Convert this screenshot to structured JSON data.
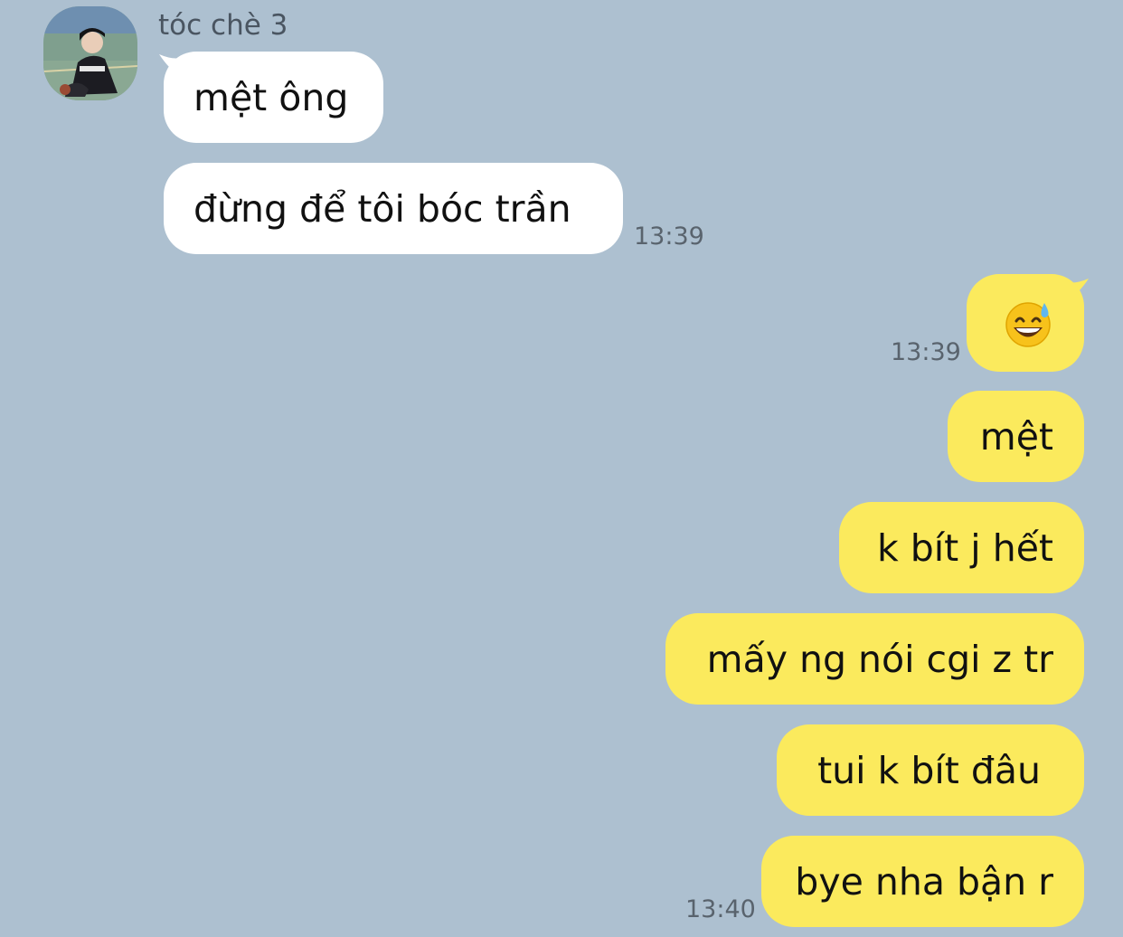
{
  "chat": {
    "sender_name": "tóc chè 3",
    "colors": {
      "background": "#adc0d0",
      "incoming_bubble": "#ffffff",
      "outgoing_bubble": "#fbea5d",
      "timestamp": "#59636d"
    },
    "messages": [
      {
        "direction": "incoming",
        "text": "mệt ông",
        "time": ""
      },
      {
        "direction": "incoming",
        "text": "đừng để tôi bóc trần",
        "time": "13:39"
      },
      {
        "direction": "outgoing",
        "type": "emoji",
        "icon": "grinning-face-with-sweat-icon",
        "text": "",
        "time": "13:39"
      },
      {
        "direction": "outgoing",
        "text": "mệt",
        "time": ""
      },
      {
        "direction": "outgoing",
        "text": "k bít j hết",
        "time": ""
      },
      {
        "direction": "outgoing",
        "text": "mấy ng nói cgi z tr",
        "time": ""
      },
      {
        "direction": "outgoing",
        "text": "tui k bít đâu",
        "time": ""
      },
      {
        "direction": "outgoing",
        "text": "bye nha bận r",
        "time": "13:40"
      }
    ]
  }
}
